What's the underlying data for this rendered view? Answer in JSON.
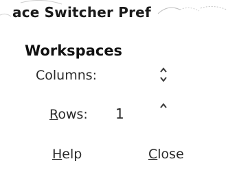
{
  "window": {
    "title": "ace Switcher Pref"
  },
  "workspaces": {
    "heading": "Workspaces",
    "columns_label": "Columns:",
    "rows_label_mnemonic": "R",
    "rows_label_rest": "ows:",
    "rows_value": "1"
  },
  "buttons": {
    "help_mnemonic": "H",
    "help_rest": "elp",
    "close_mnemonic": "C",
    "close_rest": "lose"
  },
  "icons": {
    "columns_spin": "spin-up-down-icon",
    "rows_spin": "spin-up-icon"
  }
}
